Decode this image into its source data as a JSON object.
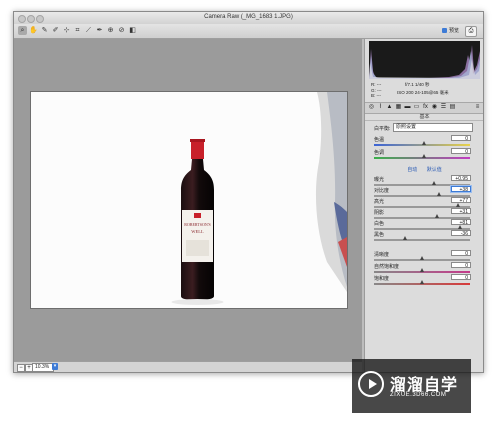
{
  "window": {
    "title": "Camera Raw (_MG_1683 1.JPG)"
  },
  "toolbar": {
    "tools": [
      "zoom-tool",
      "hand-tool",
      "white-balance-tool",
      "color-sampler-tool",
      "targeted-adjustment-tool",
      "crop-tool",
      "straighten-tool",
      "spot-removal-tool",
      "red-eye-tool",
      "adjustment-brush-tool"
    ],
    "preview_label": "预览"
  },
  "status": {
    "zoom": "10.3%"
  },
  "info": {
    "r": "R:  ---",
    "g": "G:  ---",
    "b": "B:  ---",
    "camera_line1": "f/7.1   1/40 秒",
    "camera_line2": "ISO 200   24-105@65 毫米"
  },
  "panel": {
    "section_title": "基本",
    "white_balance_label": "白平衡:",
    "white_balance_value": "原照设置",
    "auto_label": "自动",
    "default_label": "默认值",
    "sliders": [
      {
        "label": "色温",
        "value": "0",
        "pos": 0.52
      },
      {
        "label": "色调",
        "value": "0",
        "pos": 0.52
      },
      {
        "label": "曝光",
        "value": "+0.95",
        "pos": 0.62
      },
      {
        "label": "对比度",
        "value": "+38",
        "pos": 0.68,
        "focused": true
      },
      {
        "label": "高光",
        "value": "+77",
        "pos": 0.88
      },
      {
        "label": "阴影",
        "value": "+31",
        "pos": 0.66
      },
      {
        "label": "白色",
        "value": "+81",
        "pos": 0.9
      },
      {
        "label": "黑色",
        "value": "-36",
        "pos": 0.32
      },
      {
        "label": "清晰度",
        "value": "0",
        "pos": 0.5
      },
      {
        "label": "自然饱和度",
        "value": "0",
        "pos": 0.5
      },
      {
        "label": "饱和度",
        "value": "0",
        "pos": 0.5
      }
    ]
  },
  "image": {
    "label_line1": "ROBERTSON'S",
    "label_line2": "WELL"
  },
  "watermark": {
    "brand": "溜溜自学",
    "url": "ZIXUE.3D66.COM"
  }
}
